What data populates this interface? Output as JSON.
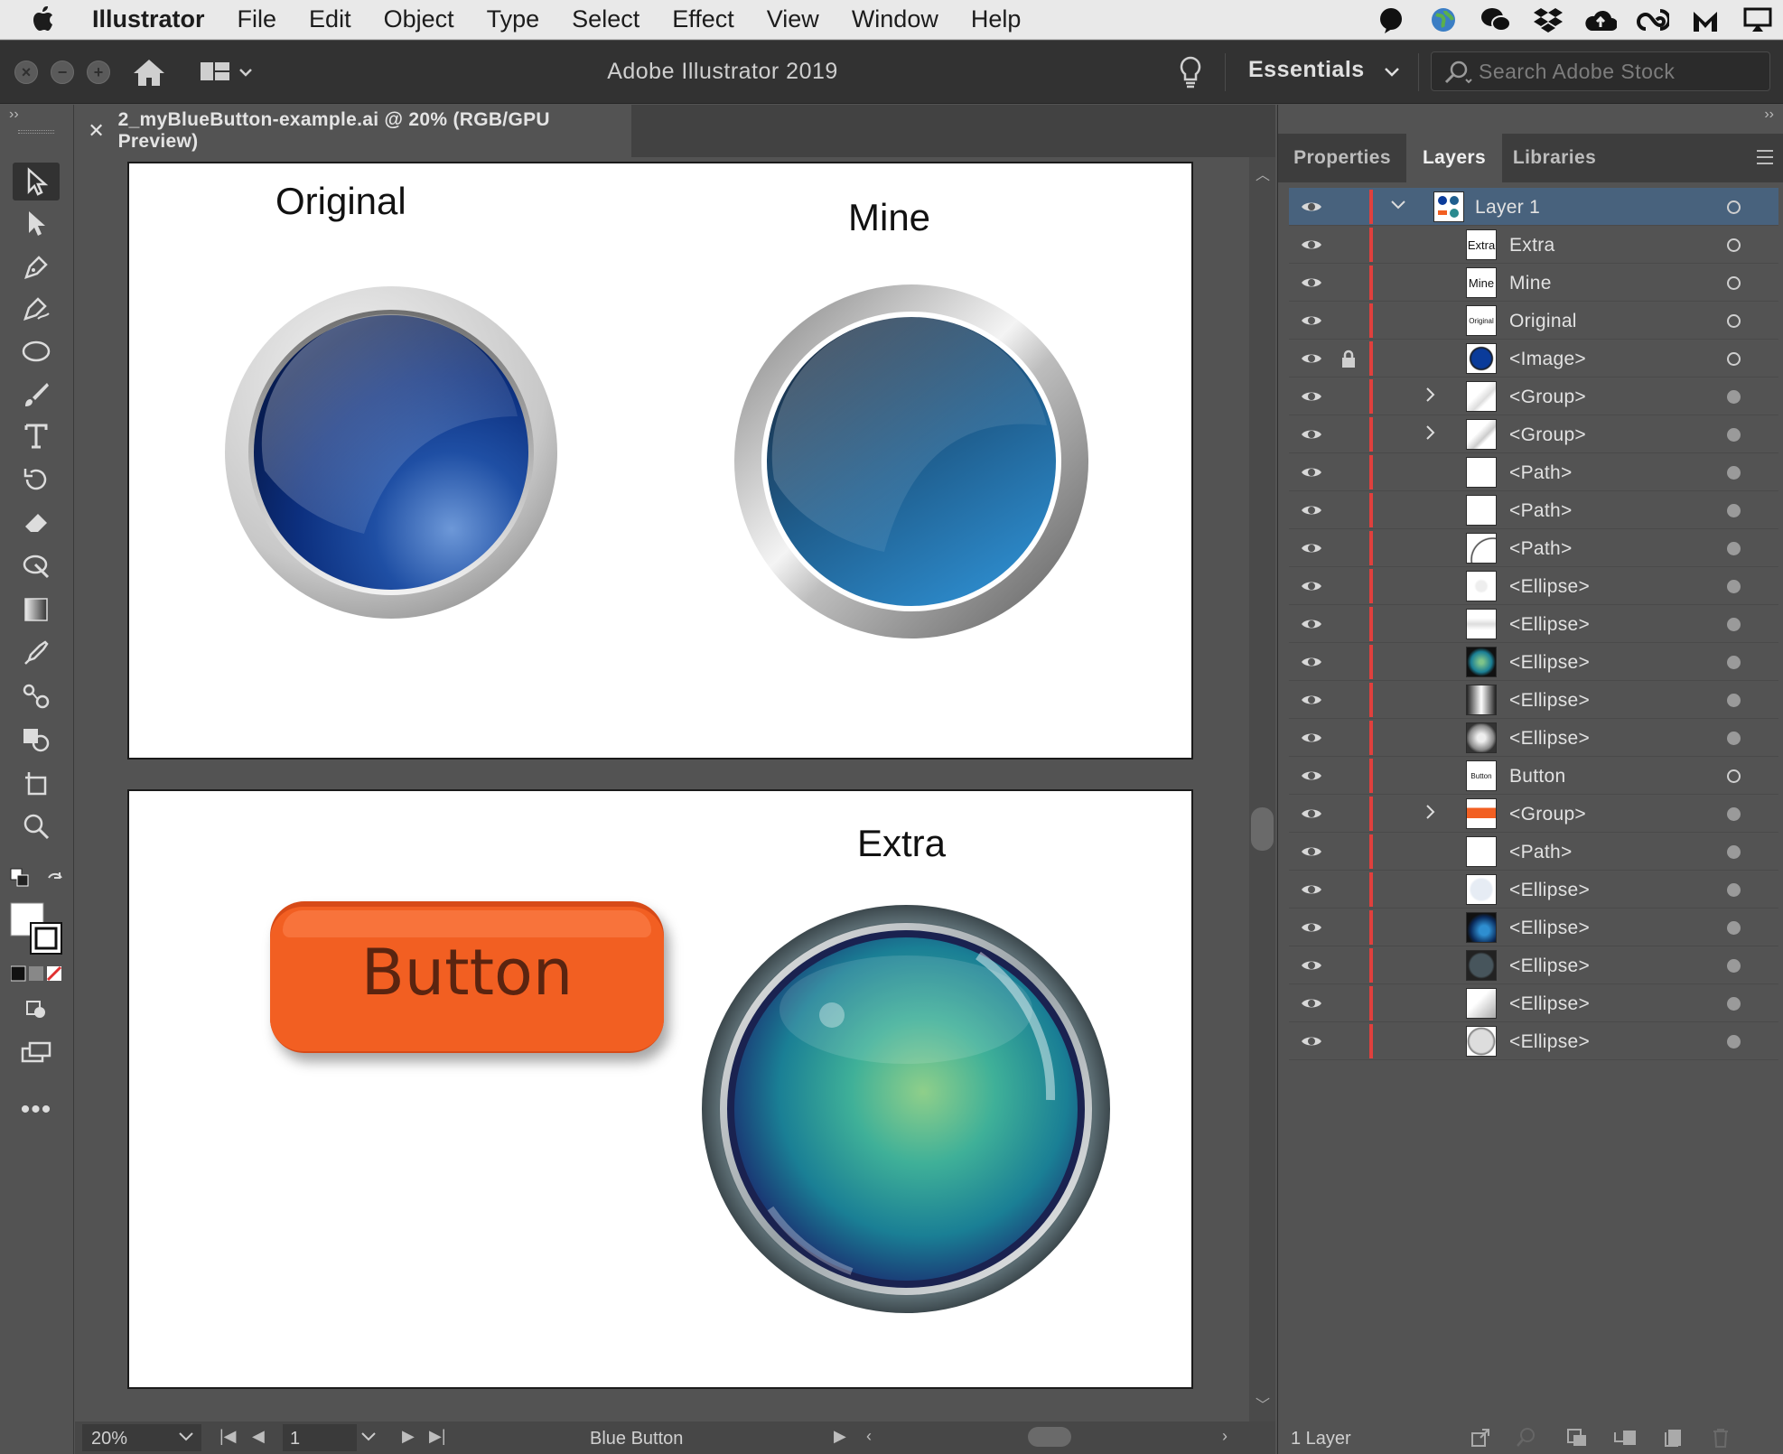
{
  "menubar": {
    "items": [
      "Illustrator",
      "File",
      "Edit",
      "Object",
      "Type",
      "Select",
      "Effect",
      "View",
      "Window",
      "Help"
    ],
    "status_icons": [
      "chat-bubble-icon",
      "globe-icon",
      "wechat-icon",
      "dropbox-icon",
      "cloud-upload-icon",
      "creative-cloud-icon",
      "malwarebytes-icon",
      "airplay-icon"
    ]
  },
  "appbar": {
    "title": "Adobe Illustrator 2019",
    "workspace": "Essentials",
    "search_placeholder": "Search Adobe Stock"
  },
  "document": {
    "tab_title": "2_myBlueButton-example.ai @ 20% (RGB/GPU Preview)",
    "artboard1": {
      "label_original": "Original",
      "label_mine": "Mine"
    },
    "artboard2": {
      "label_extra": "Extra",
      "button_text": "Button"
    },
    "colors": {
      "orange": "#f25f22",
      "blue_dark": "#0c2f7e",
      "teal": "#22a3b0"
    }
  },
  "status": {
    "zoom": "20%",
    "page": "1",
    "doc_status": "Blue Button"
  },
  "panel": {
    "tabs": [
      "Properties",
      "Layers",
      "Libraries"
    ],
    "active_tab": "Layers",
    "layers": [
      {
        "name": "Layer 1",
        "thumb": "",
        "expanded": true
      },
      {
        "name": "Extra",
        "thumb": "Extra"
      },
      {
        "name": "Mine",
        "thumb": "Mine"
      },
      {
        "name": "Original",
        "thumb": "Original"
      },
      {
        "name": "<Image>",
        "thumb": "",
        "locked": true
      },
      {
        "name": "<Group>",
        "thumb": "",
        "expandable": true
      },
      {
        "name": "<Group>",
        "thumb": "",
        "expandable": true
      },
      {
        "name": "<Path>",
        "thumb": ""
      },
      {
        "name": "<Path>",
        "thumb": ""
      },
      {
        "name": "<Path>",
        "thumb": ""
      },
      {
        "name": "<Ellipse>",
        "thumb": ""
      },
      {
        "name": "<Ellipse>",
        "thumb": ""
      },
      {
        "name": "<Ellipse>",
        "thumb": ""
      },
      {
        "name": "<Ellipse>",
        "thumb": ""
      },
      {
        "name": "<Ellipse>",
        "thumb": ""
      },
      {
        "name": "Button",
        "thumb": "Button"
      },
      {
        "name": "<Group>",
        "thumb": "",
        "expandable": true
      },
      {
        "name": "<Path>",
        "thumb": ""
      },
      {
        "name": "<Ellipse>",
        "thumb": ""
      },
      {
        "name": "<Ellipse>",
        "thumb": ""
      },
      {
        "name": "<Ellipse>",
        "thumb": ""
      },
      {
        "name": "<Ellipse>",
        "thumb": ""
      },
      {
        "name": "<Ellipse>",
        "thumb": ""
      }
    ],
    "footer_count": "1 Layer"
  }
}
